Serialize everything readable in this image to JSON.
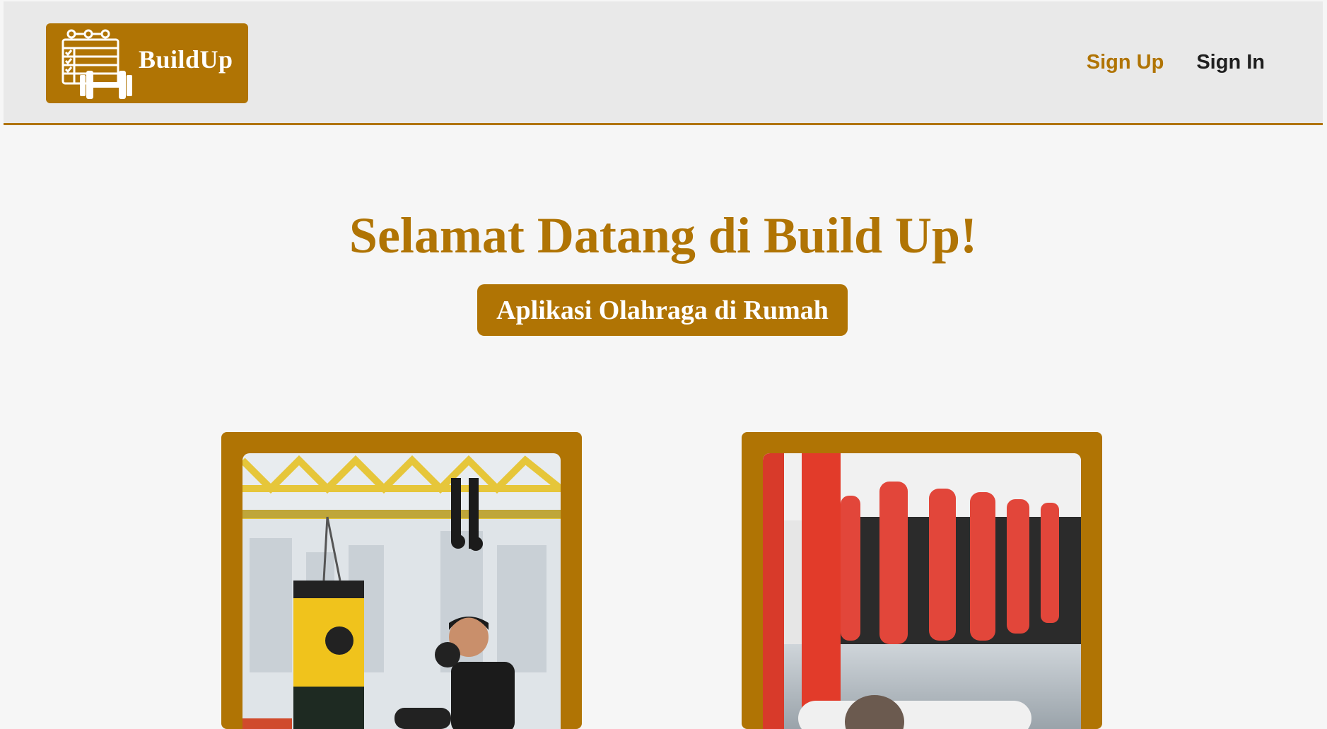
{
  "brand": {
    "name": "BuildUp"
  },
  "nav": {
    "signup_label": "Sign Up",
    "signin_label": "Sign In"
  },
  "hero": {
    "title": "Selamat Datang di Build Up!",
    "subtitle": "Aplikasi Olahraga di Rumah"
  },
  "colors": {
    "accent": "#b07404",
    "header_bg": "#e9e9e9",
    "page_bg": "#f6f6f6"
  },
  "icons": {
    "logo": "calendar-dumbbell-icon"
  }
}
